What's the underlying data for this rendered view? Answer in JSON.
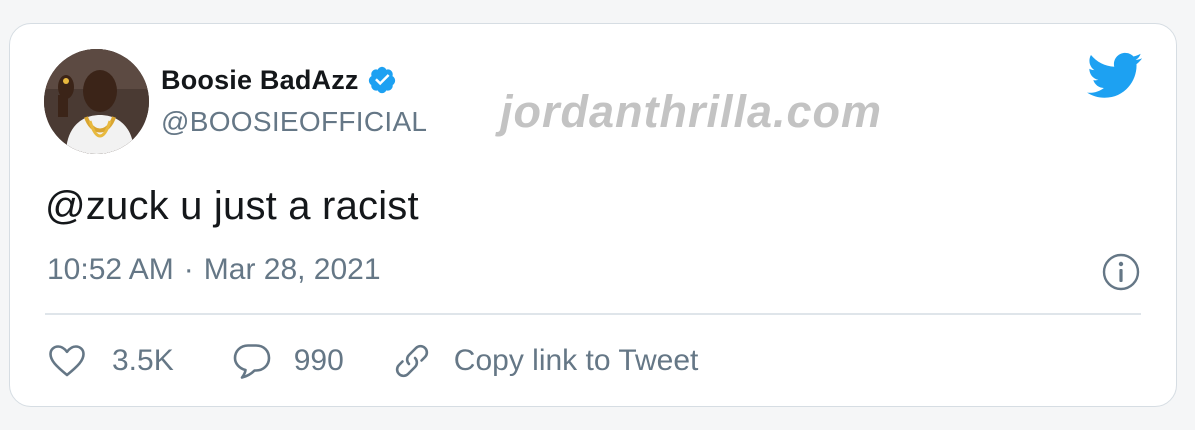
{
  "author": {
    "name": "Boosie BadAzz",
    "handle": "@BOOSIEOFFICIAL",
    "verified": true
  },
  "watermark": "jordanthrilla.com",
  "tweet": {
    "text": "@zuck u just a racist",
    "time": "10:52 AM",
    "separator": "·",
    "date": "Mar 28, 2021"
  },
  "actions": {
    "likes": "3.5K",
    "replies": "990",
    "copy_link": "Copy link to Tweet"
  },
  "icons": {
    "brand": "twitter-bird-icon",
    "verified": "verified-badge-icon",
    "info": "info-icon",
    "like": "heart-icon",
    "reply": "speech-bubble-icon",
    "link": "link-icon"
  },
  "colors": {
    "accent": "#1da1f2",
    "text": "#14171a",
    "secondary": "#657786",
    "watermark": "#b9b9b9"
  }
}
